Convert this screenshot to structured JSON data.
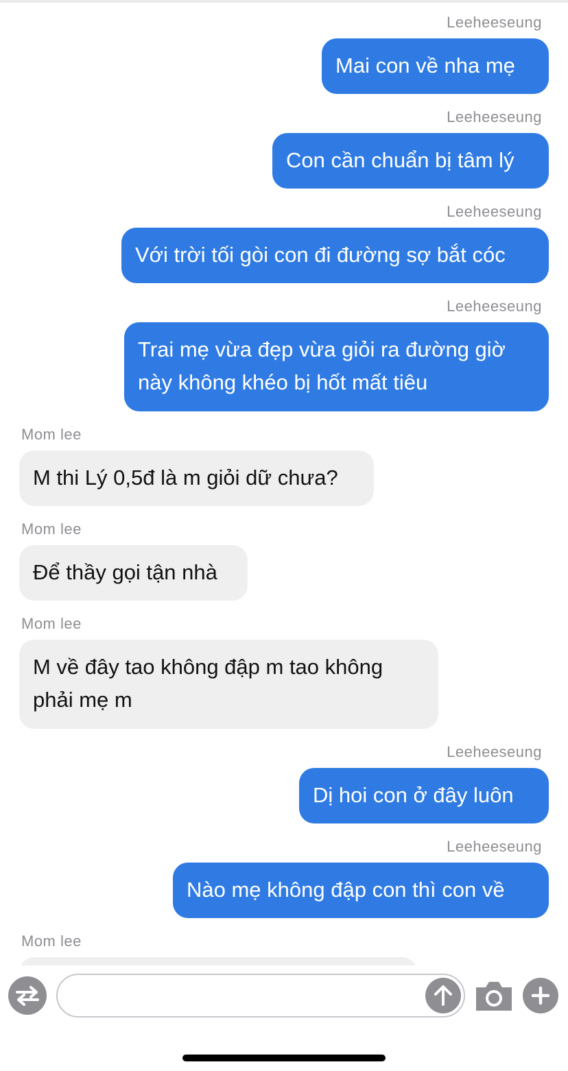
{
  "messages": [
    {
      "sender": "Leeheeseung",
      "text": "Mai con về nha mẹ",
      "direction": "out"
    },
    {
      "sender": "Leeheeseung",
      "text": "Con cần chuẩn bị tâm lý",
      "direction": "out"
    },
    {
      "sender": "Leeheeseung",
      "text": "Với trời tối gòi con đi đường sợ bắt cóc",
      "direction": "out"
    },
    {
      "sender": "Leeheeseung",
      "text": "Trai mẹ vừa đẹp vừa giỏi ra đường giờ này không khéo bị hốt mất tiêu",
      "direction": "out"
    },
    {
      "sender": "Mom lee",
      "text": "M thi Lý 0,5đ là m giỏi dữ chưa?",
      "direction": "in"
    },
    {
      "sender": "Mom lee",
      "text": "Để thầy gọi tận nhà",
      "direction": "in"
    },
    {
      "sender": "Mom lee",
      "text": "M về đây tao không đập m tao không phải mẹ m",
      "direction": "in"
    },
    {
      "sender": "Leeheeseung",
      "text": "Dị hoi con ở đây luôn",
      "direction": "out"
    },
    {
      "sender": "Leeheeseung",
      "text": "Nào mẹ không đập con thì con về",
      "direction": "out"
    },
    {
      "sender": "Mom lee",
      "text": "",
      "direction": "in"
    }
  ],
  "composer": {
    "input_value": "",
    "left_icon": "swap-arrows-icon",
    "send_icon": "arrow-up-icon",
    "camera_icon": "camera-icon",
    "add_icon": "plus-icon"
  },
  "colors": {
    "outgoing_bubble": "#2f7be3",
    "incoming_bubble": "#efefef",
    "sender_label": "#8e8e93",
    "icon_gray": "#8e8e93"
  }
}
